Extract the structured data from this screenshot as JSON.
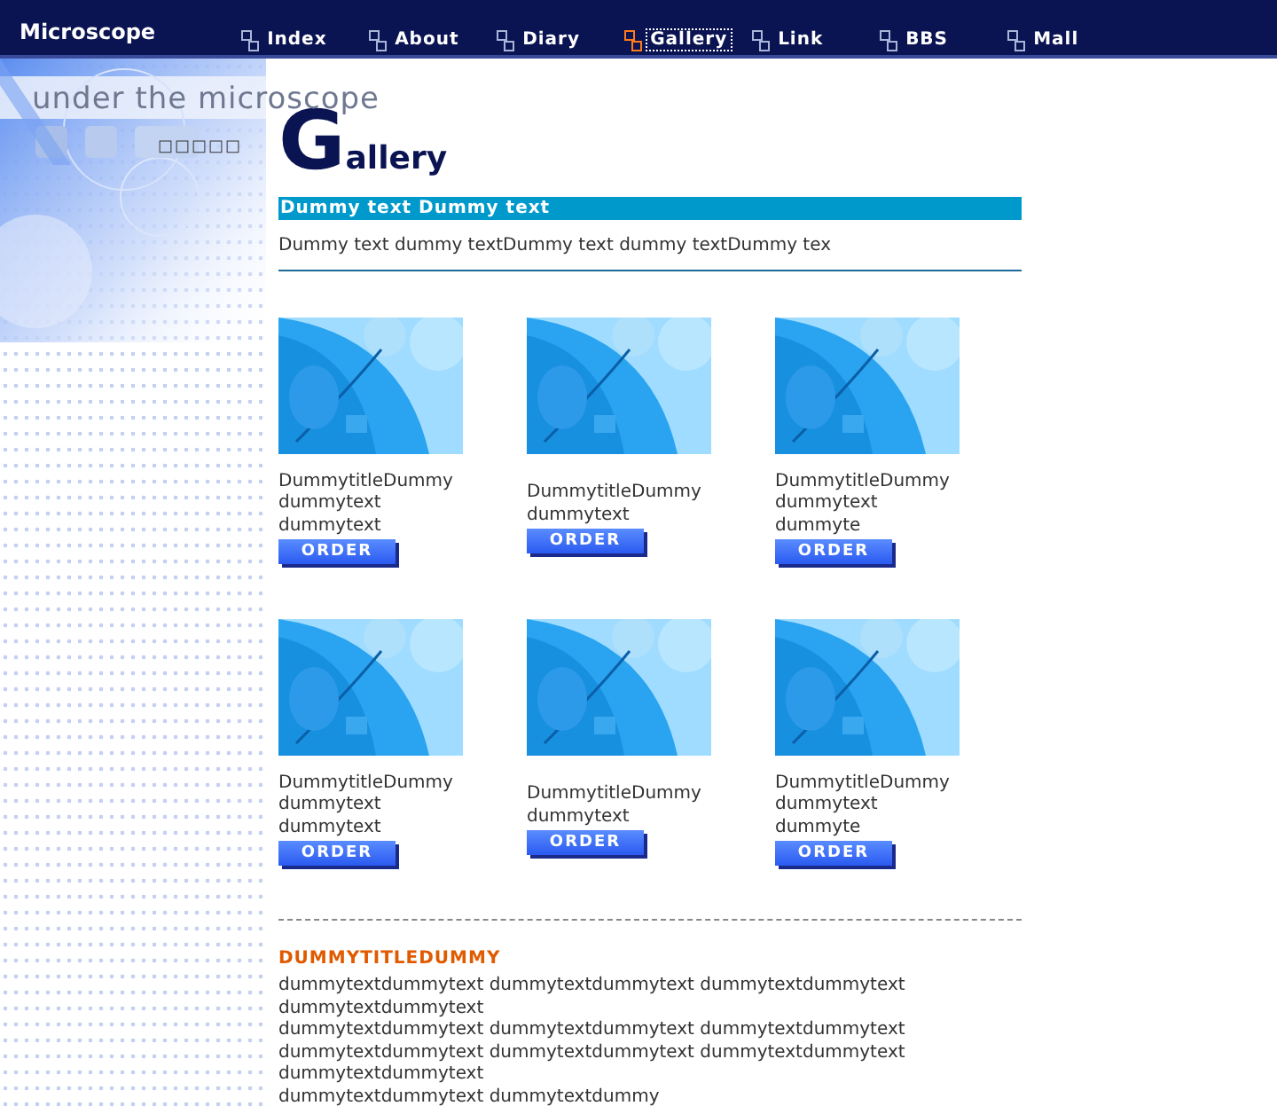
{
  "site_title": "Microscope",
  "nav": [
    {
      "label": "Index",
      "selected": false
    },
    {
      "label": "About",
      "selected": false
    },
    {
      "label": "Diary",
      "selected": false
    },
    {
      "label": "Gallery",
      "selected": true
    },
    {
      "label": "Link",
      "selected": false
    },
    {
      "label": "BBS",
      "selected": false
    },
    {
      "label": "Mall",
      "selected": false
    }
  ],
  "banner": {
    "tagline": "under the microscope",
    "glyphs": "□□□□□"
  },
  "heading": "Gallery",
  "section_bar": "Dummy text Dummy text",
  "intro": "Dummy text dummy textDummy text dummy textDummy tex",
  "products": [
    {
      "lines": [
        "DummytitleDummy",
        "dummytext",
        "dummytext"
      ],
      "button": "ORDER"
    },
    {
      "lines": [
        "DummytitleDummy",
        "dummytext"
      ],
      "button": "ORDER"
    },
    {
      "lines": [
        "DummytitleDummy",
        "dummytext",
        "dummyte"
      ],
      "button": "ORDER"
    },
    {
      "lines": [
        "DummytitleDummy",
        "dummytext",
        "dummytext"
      ],
      "button": "ORDER"
    },
    {
      "lines": [
        "DummytitleDummy",
        "dummytext"
      ],
      "button": "ORDER"
    },
    {
      "lines": [
        "DummytitleDummy",
        "dummytext",
        "dummyte"
      ],
      "button": "ORDER"
    }
  ],
  "article": {
    "title": "DUMMYTITLEDUMMY",
    "lines": [
      "dummytextdummytext dummytextdummytext dummytextdummytext",
      "dummytextdummytext",
      "dummytextdummytext dummytextdummytext dummytextdummytext",
      "dummytextdummytext dummytextdummytext dummytextdummytext",
      "dummytextdummytext",
      "dummytextdummytext dummytextdummy"
    ]
  }
}
